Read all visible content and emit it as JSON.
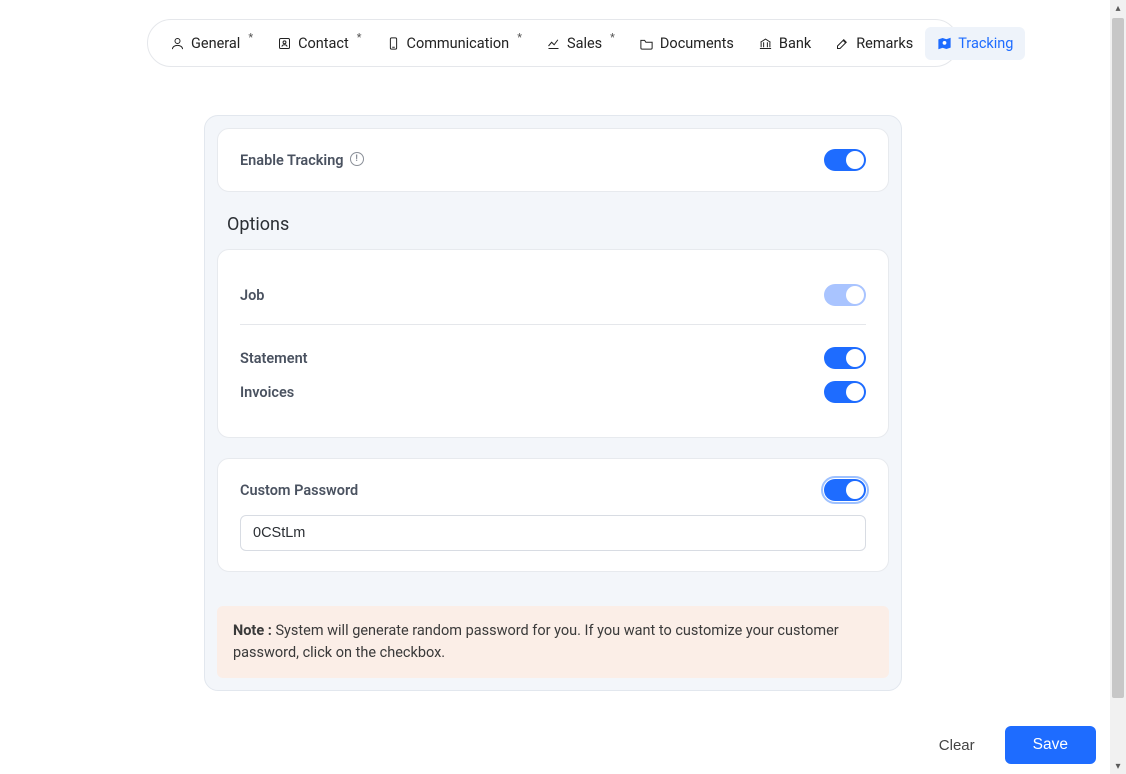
{
  "tabs": [
    {
      "label": "General",
      "asterisk": true
    },
    {
      "label": "Contact",
      "asterisk": true
    },
    {
      "label": "Communication",
      "asterisk": true
    },
    {
      "label": "Sales",
      "asterisk": true
    },
    {
      "label": "Documents",
      "asterisk": false
    },
    {
      "label": "Bank",
      "asterisk": false
    },
    {
      "label": "Remarks",
      "asterisk": false
    },
    {
      "label": "Tracking",
      "asterisk": false,
      "active": true
    }
  ],
  "tracking": {
    "enable_label": "Enable Tracking",
    "enable_on": true,
    "options_title": "Options",
    "options": {
      "job": {
        "label": "Job",
        "on": false
      },
      "statement": {
        "label": "Statement",
        "on": true
      },
      "invoices": {
        "label": "Invoices",
        "on": true
      }
    },
    "custom_password": {
      "label": "Custom Password",
      "on": true,
      "value": "0CStLm"
    },
    "note_prefix": "Note :",
    "note_text": " System will generate random password for you. If you want to customize your customer password, click on the checkbox."
  },
  "footer": {
    "clear": "Clear",
    "save": "Save"
  }
}
